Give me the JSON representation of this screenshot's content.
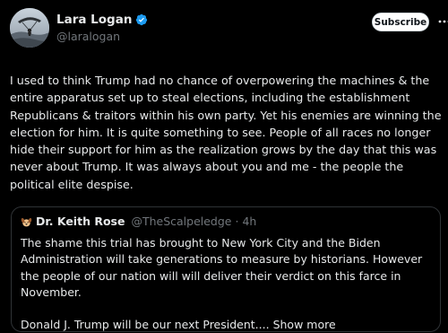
{
  "author": {
    "display_name": "Lara Logan",
    "handle": "@laralogan",
    "verified": true,
    "avatar_icon": "avatar-parachute-icon"
  },
  "header": {
    "subscribe_label": "Subscribe",
    "more_icon": "more-horizontal-icon"
  },
  "post": {
    "text": "I used to think Trump had no chance of overpowering the machines & the entire apparatus set up to steal elections, including the establishment Republicans & traitors within his own party. Yet his enemies are winning the election for him. It is quite something to see. People of all races no longer hide their support for him as the realization grows by the day that this was never about Trump. It was always about you and me - the people the political elite despise."
  },
  "quote": {
    "icon": "dog-emoji-icon",
    "display_name": "Dr. Keith Rose",
    "handle": "@TheScalpeledge",
    "separator": "·",
    "time": "4h",
    "paragraph1": "The shame this trial has brought to New York City and the Biden Administration will take generations to measure by historians. However the people of our nation will will deliver their verdict on this farce in November.",
    "paragraph2": "Donald J. Trump will be our next President....",
    "show_more": "Show more"
  },
  "colors": {
    "background": "#000000",
    "text_primary": "#e7e9ea",
    "text_secondary": "#71767b",
    "verified_blue": "#1d9bf0",
    "border": "#2f3336"
  }
}
